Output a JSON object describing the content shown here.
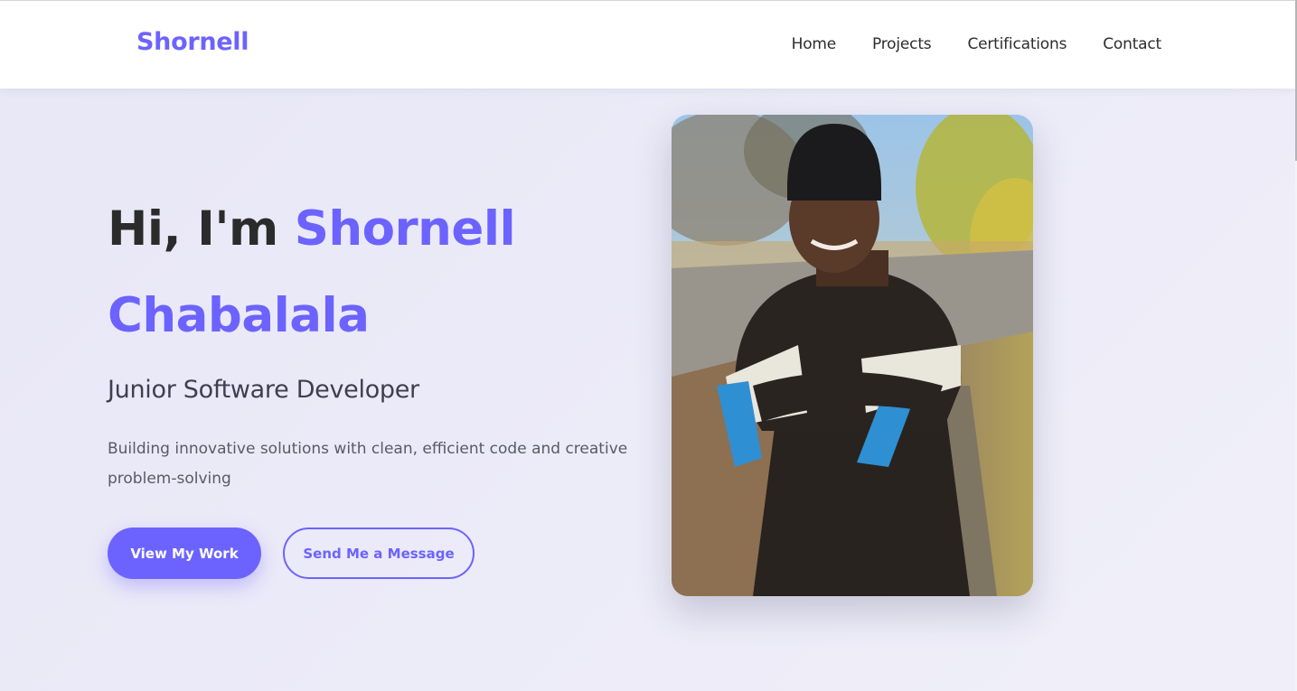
{
  "navbar": {
    "brand": "Shornell",
    "links": [
      "Home",
      "Projects",
      "Certifications",
      "Contact"
    ]
  },
  "hero": {
    "greeting": "Hi, I'm ",
    "name_first": "Shornell",
    "name_last": "Chabalala",
    "subtitle": "Junior Software Developer",
    "description": "Building innovative solutions with clean, efficient code and creative problem-solving",
    "primary_button": "View My Work",
    "secondary_button": "Send Me a Message"
  },
  "colors": {
    "accent": "#6c63ff",
    "heading": "#2b2b2b",
    "background": "#ebeaf7"
  },
  "icons": {
    "profile_photo": "portrait-photo"
  }
}
